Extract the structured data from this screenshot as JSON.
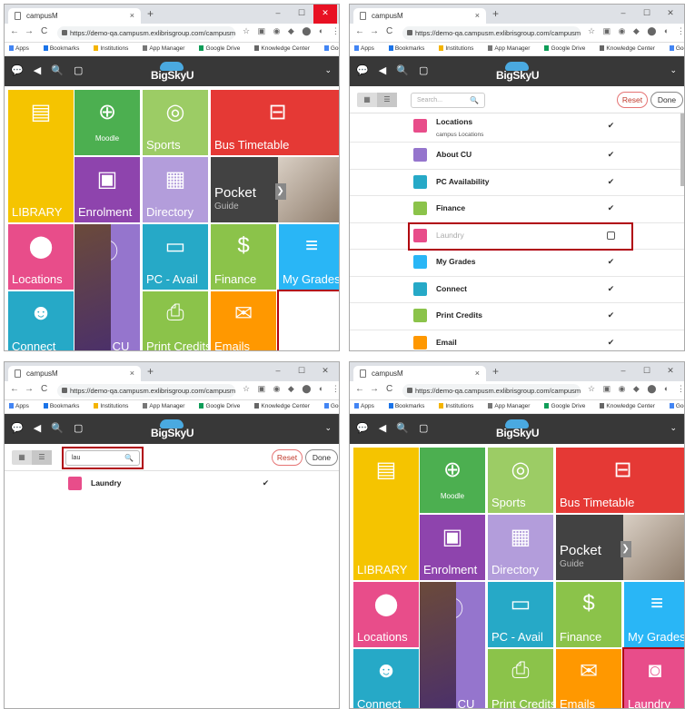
{
  "browser": {
    "tab_title": "campusM",
    "tab_close": "×",
    "new_tab": "+",
    "url": "https://demo-qa.campusm.exlibrisgroup.com/campusm/h...",
    "controls": {
      "min": "–",
      "max": "☐",
      "close": "✕"
    },
    "nav": {
      "back": "←",
      "forward": "→",
      "reload": "C"
    },
    "extensions": "☆ ▣ ◉ ◆ ⬤ ◐ ⋮",
    "bookmarks": [
      "Apps",
      "Bookmarks",
      "Institutions",
      "App Manager",
      "Google Drive",
      "Knowledge Center",
      "Google Docs",
      "»"
    ],
    "colors": {
      "tabbar": "#dee1e6",
      "close_hover": "#e81123"
    }
  },
  "app": {
    "header_icons": "💬 ◀ 🔍 ▢",
    "logo_text": "BigSkyU",
    "menu_chevron": "⌄",
    "header_color": "#383838"
  },
  "tiles": {
    "library": {
      "label": "LIBRARY",
      "color": "#f5c400",
      "icon": "books-icon"
    },
    "moodle": {
      "label": "Moodle",
      "color": "#4caf50",
      "icon": "globe-cursor-icon"
    },
    "sports": {
      "label": "Sports",
      "color": "#9ccc65",
      "icon": "tennis-icon"
    },
    "bus": {
      "label": "Bus Timetable",
      "color": "#e53935",
      "icon": "bus-icon"
    },
    "enrolment": {
      "label": "Enrolment",
      "color": "#8e44ad",
      "icon": "enrolment-icon"
    },
    "directory": {
      "label": "Directory",
      "color": "#b39ddb",
      "icon": "directory-icon"
    },
    "pocket": {
      "label": "Pocket",
      "sub": "Guide",
      "color": "#424242",
      "icon": "chevron-right-icon"
    },
    "locations": {
      "label": "Locations",
      "color": "#e84d8a",
      "icon": "location-pin-icon"
    },
    "about": {
      "label": "About CU",
      "color": "#9575cd",
      "icon": "info-icon"
    },
    "pc": {
      "label": "PC - Avail",
      "color": "#26a9c7",
      "icon": "monitor-icon"
    },
    "finance": {
      "label": "Finance",
      "color": "#8bc34a",
      "icon": "dollar-icon"
    },
    "grades": {
      "label": "My Grades",
      "color": "#29b6f6",
      "icon": "grades-icon"
    },
    "connect": {
      "label": "Connect",
      "color": "#26a9c7",
      "icon": "connect-icon"
    },
    "print": {
      "label": "Print Credits",
      "color": "#8bc34a",
      "icon": "printer-icon"
    },
    "emails": {
      "label": "Emails",
      "color": "#ff9800",
      "icon": "email-icon"
    },
    "laundry": {
      "label": "Laundry",
      "color": "#e84d8a",
      "icon": "washing-machine-icon"
    }
  },
  "edit": {
    "grid_view": "▦",
    "list_view": "☰",
    "search_placeholder": "Search...",
    "search_icon": "🔍",
    "reset": "Reset",
    "done": "Done",
    "search_value": "lau",
    "rows": [
      {
        "title": "Locations",
        "sub": "campus Locations",
        "checked": "✔",
        "color": "#e84d8a"
      },
      {
        "title": "About CU",
        "checked": "✔",
        "color": "#9575cd"
      },
      {
        "title": "PC Availability",
        "checked": "✔",
        "color": "#26a9c7"
      },
      {
        "title": "Finance",
        "checked": "✔",
        "color": "#8bc34a"
      },
      {
        "title": "Laundry",
        "checked": "",
        "color": "#e84d8a"
      },
      {
        "title": "My Grades",
        "checked": "✔",
        "color": "#29b6f6"
      },
      {
        "title": "Connect",
        "checked": "✔",
        "color": "#26a9c7"
      },
      {
        "title": "Print Credits",
        "checked": "✔",
        "color": "#8bc34a"
      },
      {
        "title": "Email",
        "checked": "✔",
        "color": "#ff9800"
      }
    ],
    "filtered_row": {
      "title": "Laundry",
      "checked": "✔"
    }
  }
}
